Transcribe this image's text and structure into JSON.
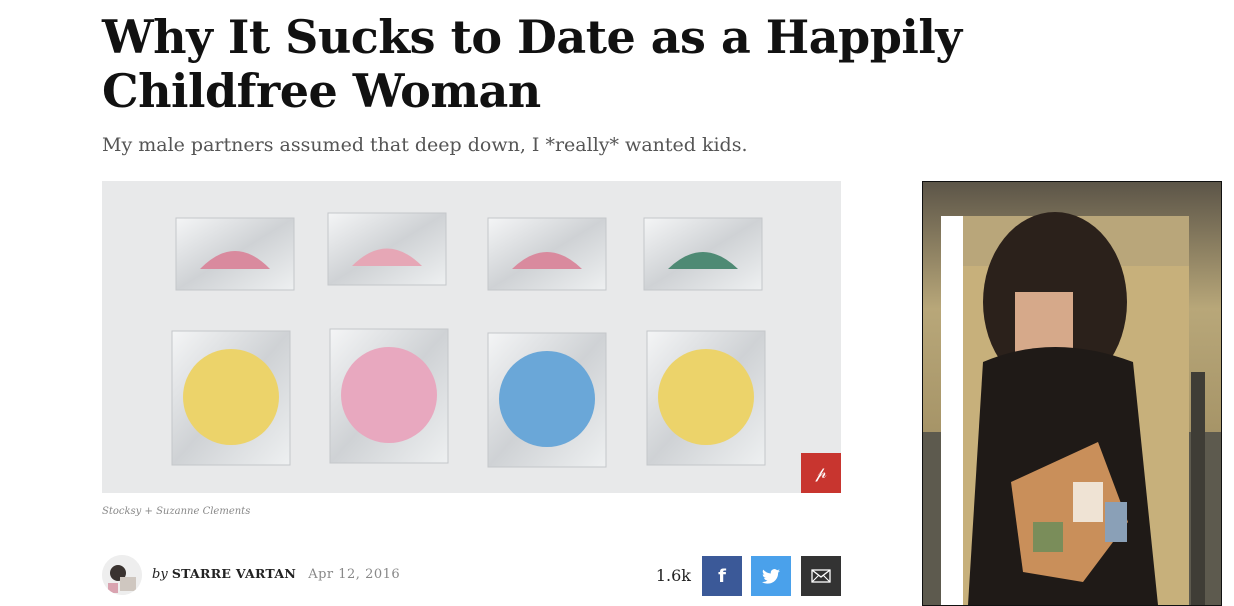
{
  "article": {
    "headline": "Why It Sucks to Date as a Happily Childfree Woman",
    "dek": "My male partners assumed that deep down, I *really* wanted kids.",
    "image_credit": "Stocksy + Suzanne Clements",
    "byline_prefix": "by",
    "author": "STARRE VARTAN",
    "date": "Apr 12, 2016"
  },
  "share": {
    "count": "1.6k",
    "pin_icon": "pinterest-icon",
    "facebook_icon": "facebook-icon",
    "twitter_icon": "twitter-icon",
    "email_icon": "email-icon"
  },
  "colors": {
    "pinterest": "#c8352f",
    "facebook": "#3b5998",
    "twitter": "#4aa1eb",
    "email": "#333333"
  }
}
